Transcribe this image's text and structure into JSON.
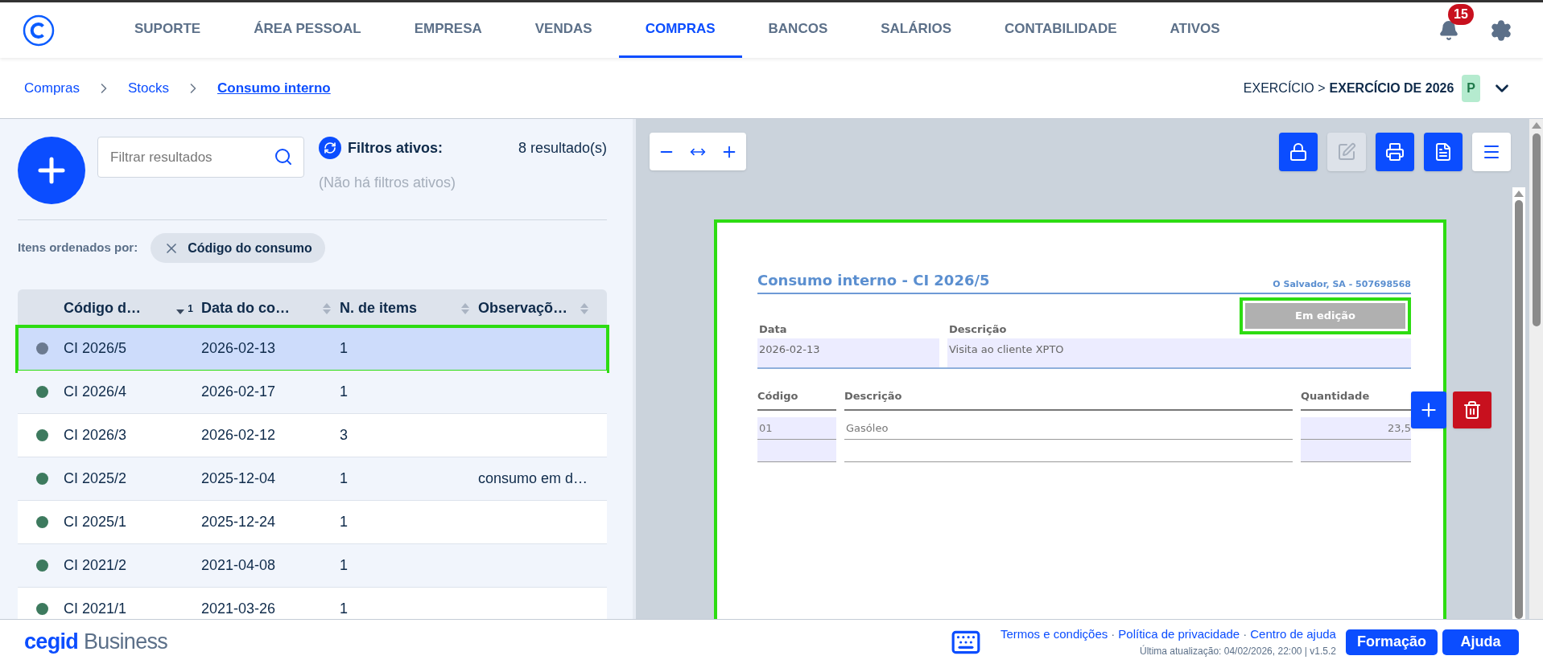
{
  "app_bar": {
    "nav": [
      {
        "label": "SUPORTE",
        "selected": false
      },
      {
        "label": "ÁREA PESSOAL",
        "selected": false
      },
      {
        "label": "EMPRESA",
        "selected": false
      },
      {
        "label": "VENDAS",
        "selected": false
      },
      {
        "label": "COMPRAS",
        "selected": true
      },
      {
        "label": "BANCOS",
        "selected": false
      },
      {
        "label": "SALÁRIOS",
        "selected": false
      },
      {
        "label": "CONTABILIDADE",
        "selected": false
      },
      {
        "label": "ATIVOS",
        "selected": false
      }
    ],
    "notifications": {
      "count": "15"
    }
  },
  "breadcrumb": [
    {
      "label": "Compras",
      "current": false
    },
    {
      "label": "Stocks",
      "current": false
    },
    {
      "label": "Consumo interno",
      "current": true
    }
  ],
  "fiscal_year": {
    "prefix": "EXERCÍCIO >",
    "value": "EXERCÍCIO DE 2026",
    "badge": "P"
  },
  "list_panel": {
    "search": {
      "placeholder": "Filtrar resultados"
    },
    "filters_title": "Filtros ativos:",
    "filters_empty": "(Não há filtros ativos)",
    "result_count": "8 resultado(s)",
    "sort_label": "Itens ordenados por:",
    "sort_chip": "Código do consumo",
    "table": {
      "columns": [
        {
          "label": "Código d…",
          "sorted_descending": true,
          "sort_index": "1"
        },
        {
          "label": "Data do co…",
          "sorted_descending": false
        },
        {
          "label": "N. de items",
          "sorted_descending": false
        },
        {
          "label": "Observaçõ…",
          "sorted_descending": false
        }
      ],
      "rows": [
        {
          "cells": [
            "CI 2026/5",
            "2026-02-13",
            "1"
          ],
          "color": "#6b7a90",
          "selected": true,
          "highlighted": true
        },
        {
          "cells": [
            "CI 2026/4",
            "2026-02-17",
            "1"
          ],
          "color": "#3d7a5e",
          "selected": false,
          "highlighted": false
        },
        {
          "cells": [
            "CI 2026/3",
            "2026-02-12",
            "3"
          ],
          "color": "#3d7a5e",
          "selected": false,
          "highlighted": false
        },
        {
          "cells": [
            "CI 2025/2",
            "2025-12-04",
            "1",
            "consumo em d…"
          ],
          "color": "#3d7a5e",
          "selected": false,
          "highlighted": false
        },
        {
          "cells": [
            "CI 2025/1",
            "2025-12-24",
            "1"
          ],
          "color": "#3d7a5e",
          "selected": false,
          "highlighted": false
        },
        {
          "cells": [
            "CI 2021/2",
            "2021-04-08",
            "1"
          ],
          "color": "#3d7a5e",
          "selected": false,
          "highlighted": false
        },
        {
          "cells": [
            "CI 2021/1",
            "2021-03-26",
            "1"
          ],
          "color": "#3d7a5e",
          "selected": false,
          "highlighted": false
        }
      ]
    }
  },
  "document": {
    "actions": [
      {
        "kind": "lock",
        "disabled": false
      },
      {
        "kind": "edit",
        "disabled": true
      },
      {
        "kind": "print",
        "disabled": false
      },
      {
        "kind": "pdf",
        "disabled": false
      },
      {
        "kind": "menu",
        "disabled": false
      }
    ],
    "page": {
      "highlighted": true,
      "title": "Consumo interno - CI 2026/5",
      "company": "O Salvador, SA - 507698568",
      "status": {
        "label": "Em edição",
        "highlighted": true
      },
      "fields": [
        {
          "label": "Data",
          "value": "2026-02-13"
        },
        {
          "label": "Descrição",
          "value": "Visita ao cliente XPTO"
        }
      ],
      "line_columns": [
        "Código",
        "Descrição",
        "Quantidade"
      ],
      "lines": [
        {
          "code": "01",
          "description": "Gasóleo",
          "quantity": "23,5"
        }
      ]
    }
  },
  "footer": {
    "brand_bold": "cegid",
    "brand_rest": "Business",
    "links": [
      "Termos e condições",
      "Política de privacidade",
      "Centro de ajuda"
    ],
    "separators": [
      "·",
      "·"
    ],
    "updated": "Última atualização: 04/02/2026, 22:00 | v1.5.2",
    "buttons": [
      "Formação",
      "Ajuda"
    ]
  }
}
